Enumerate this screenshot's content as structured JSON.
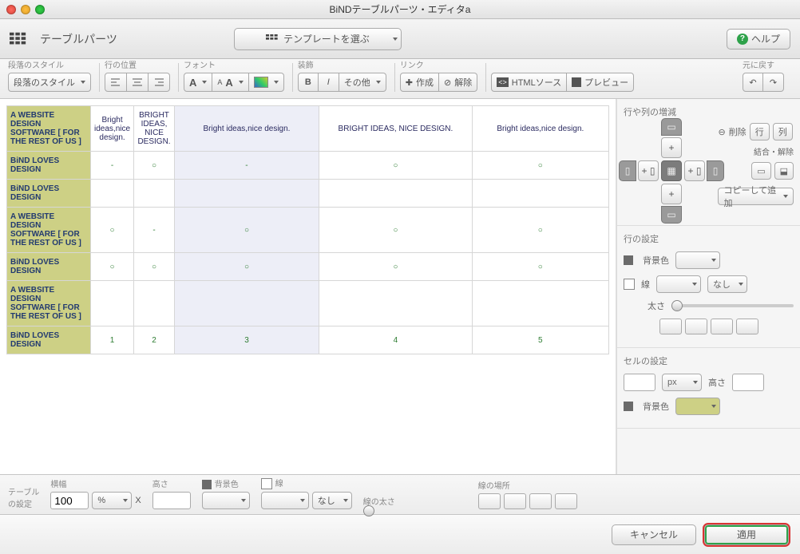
{
  "window_title": "BiNDテーブルパーツ・エディタa",
  "app_section": "テーブルパーツ",
  "template_button": "テンプレートを選ぶ",
  "help": "ヘルプ",
  "toolbar": {
    "para_style": {
      "label": "段落のスタイル",
      "value": "段落のスタイル"
    },
    "row_pos": "行の位置",
    "font": "フォント",
    "deco": "装飾",
    "link": "リンク",
    "undo": "元に戻す",
    "other": "その他",
    "make": "作成",
    "release": "解除",
    "html_src": "HTMLソース",
    "preview": "プレビュー"
  },
  "side": {
    "addremove": "行や列の増減",
    "delete": "削除",
    "row": "行",
    "col": "列",
    "merge": "結合・解除",
    "copy_add": "コピーして追加",
    "row_settings": "行の設定",
    "bg": "背景色",
    "line": "線",
    "none": "なし",
    "thickness": "太さ",
    "cell_settings": "セルの設定",
    "px": "px",
    "height": "高さ"
  },
  "bottom": {
    "table_settings": "テーブル\nの設定",
    "width": "横幅",
    "width_val": "100",
    "pct": "%",
    "x": "X",
    "height": "高さ",
    "bg": "背景色",
    "line": "線",
    "none": "なし",
    "thickness": "線の太さ",
    "where": "線の場所"
  },
  "footer": {
    "cancel": "キャンセル",
    "apply": "適用"
  },
  "table": {
    "rows": [
      {
        "head": "A WEBSITE DESIGN SOFTWARE [ FOR THE REST OF US ]",
        "c": [
          "Bright ideas,nice design.",
          "BRIGHT IDEAS, NICE DESIGN.",
          "Bright ideas,nice design.",
          "BRIGHT IDEAS, NICE DESIGN.",
          "Bright ideas,nice design."
        ]
      },
      {
        "head": "BiND LOVES DESIGN",
        "c": [
          "-",
          "○",
          "-",
          "○",
          "○"
        ]
      },
      {
        "head": "BiND LOVES DESIGN",
        "c": [
          "",
          "",
          "",
          "",
          ""
        ]
      },
      {
        "head": "A WEBSITE DESIGN SOFTWARE [ FOR THE REST OF US ]",
        "c": [
          "○",
          "-",
          "○",
          "○",
          "○"
        ]
      },
      {
        "head": "BiND LOVES DESIGN",
        "c": [
          "○",
          "○",
          "○",
          "○",
          "○"
        ]
      },
      {
        "head": "A WEBSITE DESIGN SOFTWARE [ FOR THE REST OF US ]",
        "c": [
          "",
          "",
          "",
          "",
          ""
        ]
      },
      {
        "head": "BiND LOVES DESIGN",
        "c": [
          "1",
          "2",
          "3",
          "4",
          "5"
        ]
      }
    ]
  }
}
